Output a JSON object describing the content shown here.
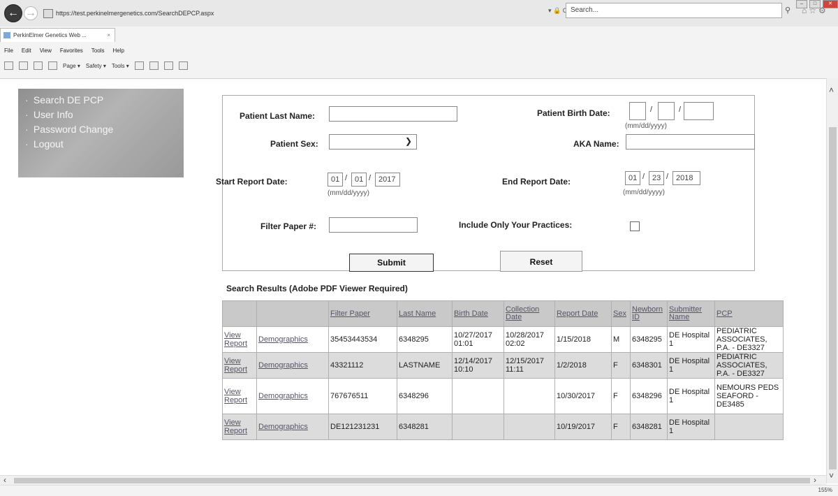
{
  "browser": {
    "url": "https://test.perkinelmergenetics.com/SearchDEPCP.aspx",
    "address_tools": "▾ 🔒 C",
    "search_placeholder": "Search...",
    "tab_title": "PerkinElmer Genetics Web ...",
    "menu": [
      "File",
      "Edit",
      "View",
      "Favorites",
      "Tools",
      "Help"
    ],
    "commands": [
      "Page ▾",
      "Safety ▾",
      "Tools ▾"
    ],
    "zoom": "155%"
  },
  "sidebar": {
    "items": [
      {
        "label": "Search DE PCP"
      },
      {
        "label": "User Info"
      },
      {
        "label": "Password Change"
      },
      {
        "label": "Logout"
      }
    ]
  },
  "form": {
    "last_name_label": "Patient Last Name:",
    "last_name_value": "",
    "birth_date_label": "Patient Birth Date:",
    "birth_mm": "",
    "birth_dd": "",
    "birth_yyyy": "",
    "date_hint": "(mm/dd/yyyy)",
    "sex_label": "Patient Sex:",
    "sex_value": "",
    "aka_label": "AKA Name:",
    "aka_value": "",
    "start_label": "Start Report Date:",
    "start_mm": "01",
    "start_dd": "01",
    "start_yyyy": "2017",
    "end_label": "End Report Date:",
    "end_mm": "01",
    "end_dd": "23",
    "end_yyyy": "2018",
    "filter_label": "Filter Paper #:",
    "filter_value": "",
    "include_label": "Include Only Your Practices:",
    "include_checked": false,
    "slash": "/",
    "submit_label": "Submit",
    "reset_label": "Reset"
  },
  "results": {
    "title": "Search Results   (Adobe PDF Viewer Required)",
    "headers": [
      "Filter Paper",
      "Last Name",
      "Birth Date",
      "Collection Date",
      "Report Date",
      "Sex",
      "Newborn ID",
      "Submitter Name",
      "PCP"
    ],
    "view_label": "View Report",
    "demo_label": "Demographics",
    "rows": [
      {
        "filter": "35453443534",
        "last": "6348295",
        "birth": "10/27/2017 01:01",
        "collection": "10/28/2017 02:02",
        "report": "1/15/2018",
        "sex": "M",
        "newborn": "6348295",
        "submitter": "DE Hospital 1",
        "pcp": "PEDIATRIC ASSOCIATES, P.A. - DE3327"
      },
      {
        "filter": "43321112",
        "last": "LASTNAME",
        "birth": "12/14/2017 10:10",
        "collection": "12/15/2017 11:11",
        "report": "1/2/2018",
        "sex": "F",
        "newborn": "6348301",
        "submitter": "DE Hospital 1",
        "pcp": "PEDIATRIC ASSOCIATES, P.A. - DE3327"
      },
      {
        "filter": "767676511",
        "last": "6348296",
        "birth": "",
        "collection": "",
        "report": "10/30/2017",
        "sex": "F",
        "newborn": "6348296",
        "submitter": "DE Hospital 1",
        "pcp": "NEMOURS PEDS SEAFORD - DE3485"
      },
      {
        "filter": "DE121231231",
        "last": "6348281",
        "birth": "",
        "collection": "",
        "report": "10/19/2017",
        "sex": "F",
        "newborn": "6348281",
        "submitter": "DE Hospital 1",
        "pcp": ""
      }
    ]
  }
}
